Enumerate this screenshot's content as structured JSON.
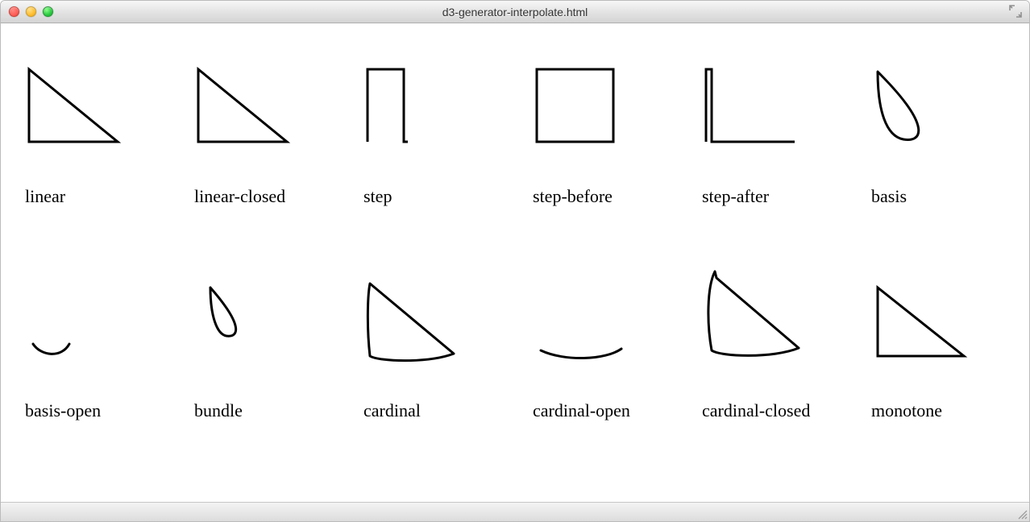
{
  "window": {
    "title": "d3-generator-interpolate.html"
  },
  "rows": [
    {
      "items": [
        {
          "label": "linear"
        },
        {
          "label": "linear-closed"
        },
        {
          "label": "step"
        },
        {
          "label": "step-before"
        },
        {
          "label": "step-after"
        },
        {
          "label": "basis"
        }
      ]
    },
    {
      "items": [
        {
          "label": "basis-open"
        },
        {
          "label": "bundle"
        },
        {
          "label": "cardinal"
        },
        {
          "label": "cardinal-open"
        },
        {
          "label": "cardinal-closed"
        },
        {
          "label": "monotone"
        }
      ]
    }
  ]
}
